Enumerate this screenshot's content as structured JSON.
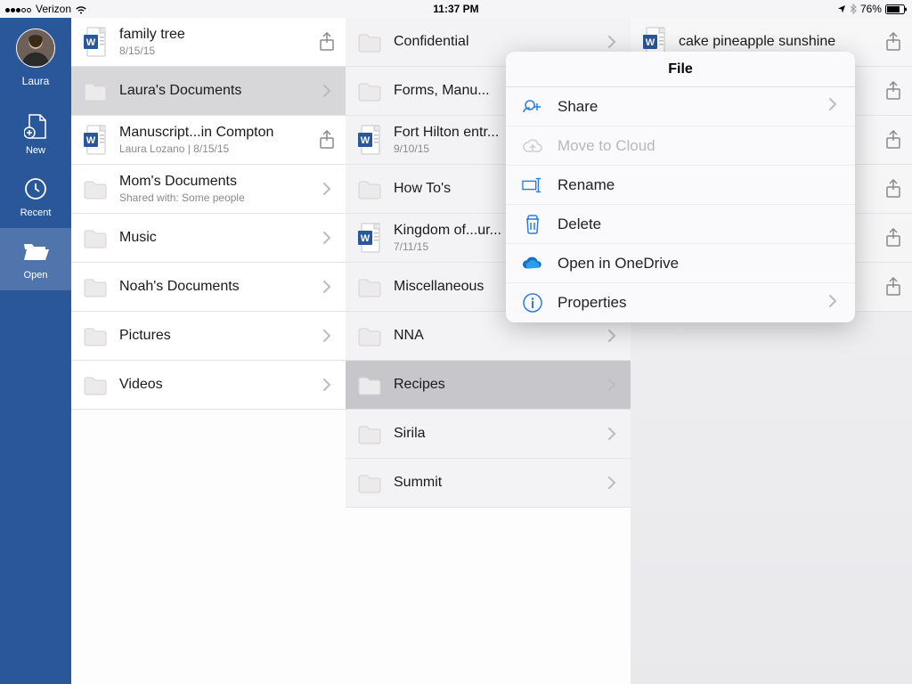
{
  "status": {
    "carrier": "Verizon",
    "time": "11:37 PM",
    "battery": "76%"
  },
  "sidebar": {
    "user": "Laura",
    "items": [
      {
        "label": "New"
      },
      {
        "label": "Recent"
      },
      {
        "label": "Open"
      }
    ]
  },
  "col1": [
    {
      "type": "file",
      "title": "family tree",
      "subtitle": "8/15/15",
      "action": "share"
    },
    {
      "type": "folder",
      "title": "Laura's Documents",
      "action": "chevron",
      "selected": true
    },
    {
      "type": "file",
      "title": "Manuscript...in Compton",
      "subtitle": "Laura Lozano | 8/15/15",
      "action": "share"
    },
    {
      "type": "folder",
      "title": "Mom's Documents",
      "subtitle": "Shared with: Some people",
      "action": "chevron"
    },
    {
      "type": "folder",
      "title": "Music",
      "action": "chevron"
    },
    {
      "type": "folder",
      "title": "Noah's Documents",
      "action": "chevron"
    },
    {
      "type": "folder",
      "title": "Pictures",
      "action": "chevron"
    },
    {
      "type": "folder",
      "title": "Videos",
      "action": "chevron"
    }
  ],
  "col2": [
    {
      "type": "folder",
      "title": "Confidential",
      "action": "chevron"
    },
    {
      "type": "folder",
      "title": "Forms, Manu...",
      "action": "chevron"
    },
    {
      "type": "file",
      "title": "Fort Hilton entr...",
      "subtitle": "9/10/15",
      "action": "share"
    },
    {
      "type": "folder",
      "title": "How To's",
      "action": "chevron"
    },
    {
      "type": "file",
      "title": "Kingdom of...ur...",
      "subtitle": "7/11/15",
      "action": "share"
    },
    {
      "type": "folder",
      "title": "Miscellaneous",
      "action": "chevron"
    },
    {
      "type": "folder",
      "title": "NNA",
      "action": "chevron"
    },
    {
      "type": "folder",
      "title": "Recipes",
      "action": "chevron",
      "selected": true
    },
    {
      "type": "folder",
      "title": "Sirila",
      "action": "chevron"
    },
    {
      "type": "folder",
      "title": "Summit",
      "action": "chevron"
    }
  ],
  "col3": [
    {
      "type": "file",
      "title": "cake pineapple sunshine",
      "action": "share"
    },
    {
      "type": "blank",
      "action": "share"
    },
    {
      "type": "blank",
      "action": "share"
    },
    {
      "type": "blank",
      "action": "share"
    },
    {
      "type": "blank",
      "action": "share"
    },
    {
      "type": "blank",
      "action": "share"
    }
  ],
  "popover": {
    "title": "File",
    "items": [
      {
        "icon": "share",
        "label": "Share",
        "chev": true
      },
      {
        "icon": "cloud",
        "label": "Move to Cloud",
        "disabled": true
      },
      {
        "icon": "rename",
        "label": "Rename"
      },
      {
        "icon": "delete",
        "label": "Delete"
      },
      {
        "icon": "onedrive",
        "label": "Open in OneDrive"
      },
      {
        "icon": "info",
        "label": "Properties",
        "chev": true
      }
    ]
  }
}
